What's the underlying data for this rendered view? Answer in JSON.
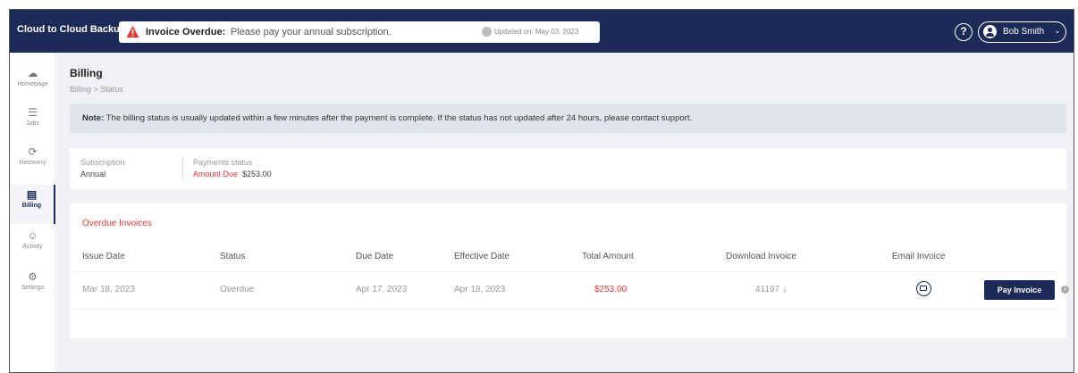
{
  "header": {
    "app_title": "Cloud to Cloud Backup",
    "alert_title": "Invoice Overdue:",
    "alert_message": "Please pay your annual subscription.",
    "updated_text": "Updated on: May 03, 2023",
    "help_label": "?",
    "user_name": "Bob Smith",
    "alert_color": "#e53935",
    "bar_color": "#1b2a57"
  },
  "sidebar": {
    "items": [
      {
        "label": "Homepage",
        "icon": "cloud-icon"
      },
      {
        "label": "Jobs",
        "icon": "jobs-icon"
      },
      {
        "label": "Recovery",
        "icon": "recovery-icon"
      },
      {
        "label": "Billing",
        "icon": "billing-icon",
        "active": true
      },
      {
        "label": "Activity",
        "icon": "person-icon"
      },
      {
        "label": "Settings",
        "icon": "gear-icon"
      }
    ]
  },
  "page": {
    "title": "Billing",
    "breadcrumb": "Billing > Status"
  },
  "note": {
    "prefix": "Note:",
    "text": " The billing status is usually updated within a few minutes after the payment is complete. If the status has not updated after 24 hours, please contact support."
  },
  "summary": {
    "subscription_label": "Subscription",
    "subscription_value": "Annual",
    "payments_label": "Payments status",
    "payments_due": "Amount Due",
    "payments_amount": "$253.00"
  },
  "invoices": {
    "title": "Overdue Invoices",
    "columns": [
      "Issue Date",
      "Status",
      "Due Date",
      "Effective Date",
      "Total Amount",
      "Download Invoice",
      "Email Invoice"
    ],
    "rows": [
      {
        "issue_date": "Mar 18, 2023",
        "status": "Overdue",
        "due_date": "Apr 17, 2023",
        "effective_date": "Apr 18, 2023",
        "total_amount": "$253.00",
        "download": "41197",
        "pay_label": "Pay Invoice"
      }
    ]
  }
}
